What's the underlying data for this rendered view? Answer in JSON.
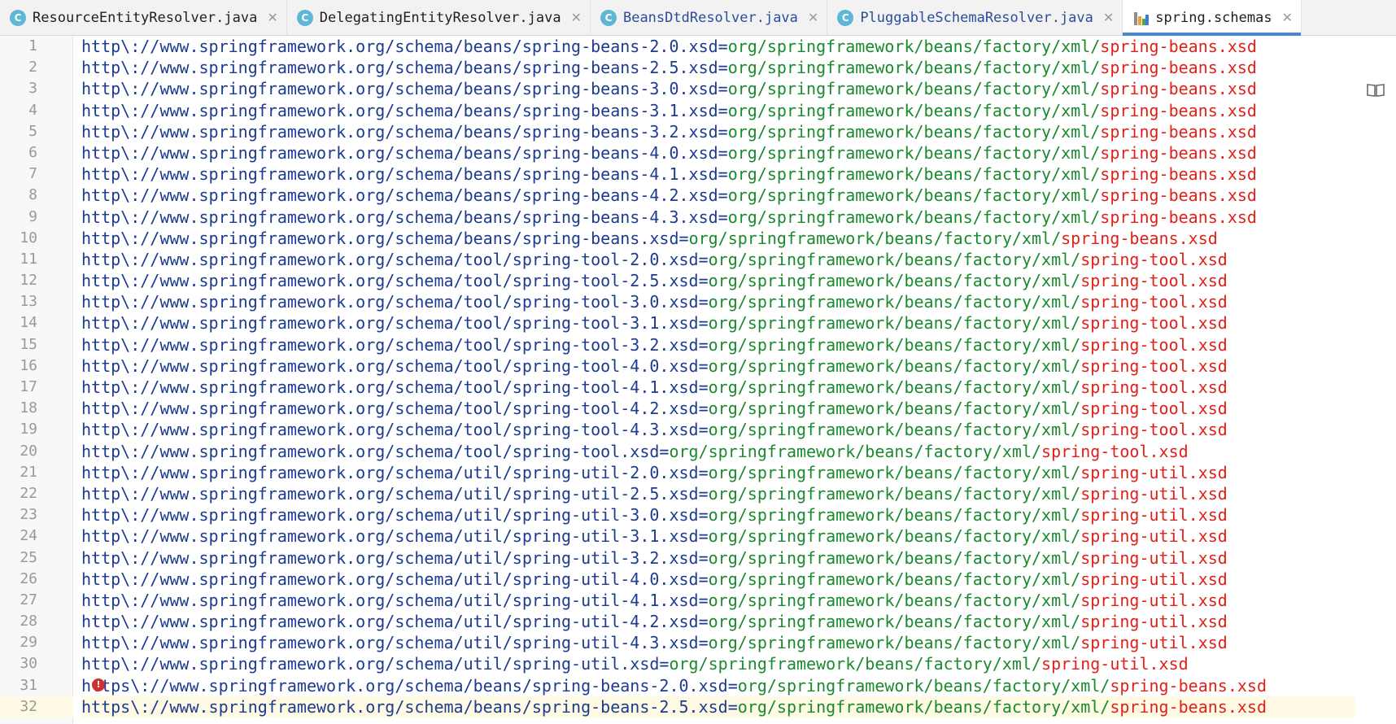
{
  "tabs": [
    {
      "label": "ResourceEntityResolver.java",
      "icon": "class-icon",
      "active": false,
      "style": "normal"
    },
    {
      "label": "DelegatingEntityResolver.java",
      "icon": "class-icon",
      "active": false,
      "style": "normal"
    },
    {
      "label": "BeansDtdResolver.java",
      "icon": "class-icon",
      "active": false,
      "style": "pending"
    },
    {
      "label": "PluggableSchemaResolver.java",
      "icon": "class-icon",
      "active": false,
      "style": "pending"
    },
    {
      "label": "spring.schemas",
      "icon": "properties-file-icon",
      "active": true,
      "style": "normal"
    }
  ],
  "tab_icon_letter": "C",
  "colors": {
    "key": "#1d3b8f",
    "value_path": "#1a8a2e",
    "value_file": "#e0211a",
    "active_tab_underline": "#4a88c7",
    "current_line": "#fffae3",
    "error": "#d13030"
  },
  "editor": {
    "current_line": 32,
    "error_line": 31,
    "lines": [
      {
        "n": "1",
        "key": "http\\://www.springframework.org/schema/beans/spring-beans-2.0.xsd",
        "eq": "=",
        "path": "org/springframework/beans/factory/xml/",
        "file": "spring-beans.xsd"
      },
      {
        "n": "2",
        "key": "http\\://www.springframework.org/schema/beans/spring-beans-2.5.xsd",
        "eq": "=",
        "path": "org/springframework/beans/factory/xml/",
        "file": "spring-beans.xsd"
      },
      {
        "n": "3",
        "key": "http\\://www.springframework.org/schema/beans/spring-beans-3.0.xsd",
        "eq": "=",
        "path": "org/springframework/beans/factory/xml/",
        "file": "spring-beans.xsd"
      },
      {
        "n": "4",
        "key": "http\\://www.springframework.org/schema/beans/spring-beans-3.1.xsd",
        "eq": "=",
        "path": "org/springframework/beans/factory/xml/",
        "file": "spring-beans.xsd"
      },
      {
        "n": "5",
        "key": "http\\://www.springframework.org/schema/beans/spring-beans-3.2.xsd",
        "eq": "=",
        "path": "org/springframework/beans/factory/xml/",
        "file": "spring-beans.xsd"
      },
      {
        "n": "6",
        "key": "http\\://www.springframework.org/schema/beans/spring-beans-4.0.xsd",
        "eq": "=",
        "path": "org/springframework/beans/factory/xml/",
        "file": "spring-beans.xsd"
      },
      {
        "n": "7",
        "key": "http\\://www.springframework.org/schema/beans/spring-beans-4.1.xsd",
        "eq": "=",
        "path": "org/springframework/beans/factory/xml/",
        "file": "spring-beans.xsd"
      },
      {
        "n": "8",
        "key": "http\\://www.springframework.org/schema/beans/spring-beans-4.2.xsd",
        "eq": "=",
        "path": "org/springframework/beans/factory/xml/",
        "file": "spring-beans.xsd"
      },
      {
        "n": "9",
        "key": "http\\://www.springframework.org/schema/beans/spring-beans-4.3.xsd",
        "eq": "=",
        "path": "org/springframework/beans/factory/xml/",
        "file": "spring-beans.xsd"
      },
      {
        "n": "10",
        "key": "http\\://www.springframework.org/schema/beans/spring-beans.xsd",
        "eq": "=",
        "path": "org/springframework/beans/factory/xml/",
        "file": "spring-beans.xsd"
      },
      {
        "n": "11",
        "key": "http\\://www.springframework.org/schema/tool/spring-tool-2.0.xsd",
        "eq": "=",
        "path": "org/springframework/beans/factory/xml/",
        "file": "spring-tool.xsd"
      },
      {
        "n": "12",
        "key": "http\\://www.springframework.org/schema/tool/spring-tool-2.5.xsd",
        "eq": "=",
        "path": "org/springframework/beans/factory/xml/",
        "file": "spring-tool.xsd"
      },
      {
        "n": "13",
        "key": "http\\://www.springframework.org/schema/tool/spring-tool-3.0.xsd",
        "eq": "=",
        "path": "org/springframework/beans/factory/xml/",
        "file": "spring-tool.xsd"
      },
      {
        "n": "14",
        "key": "http\\://www.springframework.org/schema/tool/spring-tool-3.1.xsd",
        "eq": "=",
        "path": "org/springframework/beans/factory/xml/",
        "file": "spring-tool.xsd"
      },
      {
        "n": "15",
        "key": "http\\://www.springframework.org/schema/tool/spring-tool-3.2.xsd",
        "eq": "=",
        "path": "org/springframework/beans/factory/xml/",
        "file": "spring-tool.xsd"
      },
      {
        "n": "16",
        "key": "http\\://www.springframework.org/schema/tool/spring-tool-4.0.xsd",
        "eq": "=",
        "path": "org/springframework/beans/factory/xml/",
        "file": "spring-tool.xsd"
      },
      {
        "n": "17",
        "key": "http\\://www.springframework.org/schema/tool/spring-tool-4.1.xsd",
        "eq": "=",
        "path": "org/springframework/beans/factory/xml/",
        "file": "spring-tool.xsd"
      },
      {
        "n": "18",
        "key": "http\\://www.springframework.org/schema/tool/spring-tool-4.2.xsd",
        "eq": "=",
        "path": "org/springframework/beans/factory/xml/",
        "file": "spring-tool.xsd"
      },
      {
        "n": "19",
        "key": "http\\://www.springframework.org/schema/tool/spring-tool-4.3.xsd",
        "eq": "=",
        "path": "org/springframework/beans/factory/xml/",
        "file": "spring-tool.xsd"
      },
      {
        "n": "20",
        "key": "http\\://www.springframework.org/schema/tool/spring-tool.xsd",
        "eq": "=",
        "path": "org/springframework/beans/factory/xml/",
        "file": "spring-tool.xsd"
      },
      {
        "n": "21",
        "key": "http\\://www.springframework.org/schema/util/spring-util-2.0.xsd",
        "eq": "=",
        "path": "org/springframework/beans/factory/xml/",
        "file": "spring-util.xsd"
      },
      {
        "n": "22",
        "key": "http\\://www.springframework.org/schema/util/spring-util-2.5.xsd",
        "eq": "=",
        "path": "org/springframework/beans/factory/xml/",
        "file": "spring-util.xsd"
      },
      {
        "n": "23",
        "key": "http\\://www.springframework.org/schema/util/spring-util-3.0.xsd",
        "eq": "=",
        "path": "org/springframework/beans/factory/xml/",
        "file": "spring-util.xsd"
      },
      {
        "n": "24",
        "key": "http\\://www.springframework.org/schema/util/spring-util-3.1.xsd",
        "eq": "=",
        "path": "org/springframework/beans/factory/xml/",
        "file": "spring-util.xsd"
      },
      {
        "n": "25",
        "key": "http\\://www.springframework.org/schema/util/spring-util-3.2.xsd",
        "eq": "=",
        "path": "org/springframework/beans/factory/xml/",
        "file": "spring-util.xsd"
      },
      {
        "n": "26",
        "key": "http\\://www.springframework.org/schema/util/spring-util-4.0.xsd",
        "eq": "=",
        "path": "org/springframework/beans/factory/xml/",
        "file": "spring-util.xsd"
      },
      {
        "n": "27",
        "key": "http\\://www.springframework.org/schema/util/spring-util-4.1.xsd",
        "eq": "=",
        "path": "org/springframework/beans/factory/xml/",
        "file": "spring-util.xsd"
      },
      {
        "n": "28",
        "key": "http\\://www.springframework.org/schema/util/spring-util-4.2.xsd",
        "eq": "=",
        "path": "org/springframework/beans/factory/xml/",
        "file": "spring-util.xsd"
      },
      {
        "n": "29",
        "key": "http\\://www.springframework.org/schema/util/spring-util-4.3.xsd",
        "eq": "=",
        "path": "org/springframework/beans/factory/xml/",
        "file": "spring-util.xsd"
      },
      {
        "n": "30",
        "key": "http\\://www.springframework.org/schema/util/spring-util.xsd",
        "eq": "=",
        "path": "org/springframework/beans/factory/xml/",
        "file": "spring-util.xsd"
      },
      {
        "n": "31",
        "key": "https\\://www.springframework.org/schema/beans/spring-beans-2.0.xsd",
        "eq": "=",
        "path": "org/springframework/beans/factory/xml/",
        "file": "spring-beans.xsd"
      },
      {
        "n": "32",
        "key": "https\\://www.springframework.org/schema/beans/spring-beans-2.5.xsd",
        "eq": "=",
        "path": "org/springframework/beans/factory/xml/",
        "file": "spring-beans.xsd"
      }
    ]
  },
  "right_gutter_icon": "reader-mode-icon",
  "error_icon": "error-icon",
  "error_icon_glyph": "!",
  "close_icon_glyph": "✕"
}
